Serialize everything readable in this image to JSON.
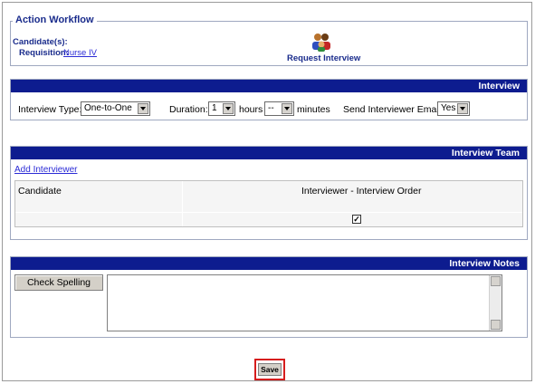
{
  "workflow": {
    "legend": "Action Workflow",
    "candidate_label": "Candidate(s):",
    "requisition_label": "Requisition:",
    "requisition_link": "Nurse IV",
    "action_label": "Request Interview",
    "action_icon": "people-icon"
  },
  "interview": {
    "header": "Interview",
    "type_label": "Interview Type:",
    "type_value": "One-to-One",
    "duration_label": "Duration:",
    "duration_hours_value": "1",
    "hours_label": "hours",
    "duration_minutes_value": "--",
    "minutes_label": "minutes",
    "email_label": "Send Interviewer Email:",
    "email_value": "Yes"
  },
  "team": {
    "header": "Interview Team",
    "add_link": "Add Interviewer",
    "columns": [
      "Candidate",
      "Interviewer - Interview Order"
    ],
    "checkbox_checked": true
  },
  "notes": {
    "header": "Interview Notes",
    "spell_button": "Check Spelling",
    "notes_value": ""
  },
  "footer": {
    "save_button": "Save",
    "highlight_color": "#d61d1d"
  },
  "colors": {
    "header_bg": "#0d1c8f",
    "title_text": "#1a2c8c",
    "link": "#2b2bd6"
  }
}
